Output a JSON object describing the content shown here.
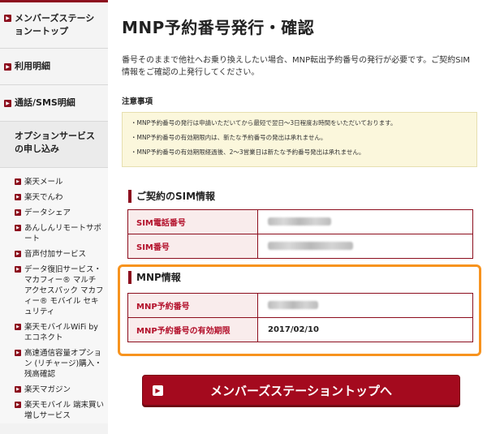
{
  "sidebar": {
    "main_items": [
      {
        "label": "メンバーズステーションートップ",
        "icon": "chevron-right-icon"
      },
      {
        "label": "利用明細",
        "icon": "chevron-right-icon"
      },
      {
        "label": "通話/SMS明細",
        "icon": "chevron-right-icon"
      }
    ],
    "section_title": "オプションサービスの申し込み",
    "sub_items": [
      {
        "label": "楽天メール"
      },
      {
        "label": "楽天でんわ"
      },
      {
        "label": "データシェア"
      },
      {
        "label": "あんしんリモートサポート"
      },
      {
        "label": "音声付加サービス"
      },
      {
        "label": "データ復旧サービス・マカフィー® マルチ アクセスパック マカフィー® モバイル セキュリティ"
      },
      {
        "label": "楽天モバイルWiFi by エコネクト"
      },
      {
        "label": "高速通信容量オプション (リチャージ)購入・残高確認"
      },
      {
        "label": "楽天マガジン"
      },
      {
        "label": "楽天モバイル 端末買い増しサービス"
      }
    ]
  },
  "main": {
    "title": "MNP予約番号発行・確認",
    "intro": "番号そのままで他社へお乗り換えしたい場合、MNP転出予約番号の発行が必要です。ご契約SIM情報をご確認の上発行してください。",
    "notes_heading": "注意事項",
    "notes": [
      "・MNP予約番号の発行は申請いただいてから最短で翌日〜3日程度お時間をいただいております。",
      "・MNP予約番号の有効期限内は、新たな予約番号の発出は承れません。",
      "・MNP予約番号の有効期限経過後、2〜3営業日は新たな予約番号発出は承れません。"
    ],
    "sim_section": {
      "heading": "ご契約のSIM情報",
      "rows": [
        {
          "label": "SIM電話番号"
        },
        {
          "label": "SIM番号"
        }
      ]
    },
    "mnp_section": {
      "heading": "MNP情報",
      "rows": [
        {
          "label": "MNP予約番号",
          "value": ""
        },
        {
          "label": "MNP予約番号の有効期限",
          "value": "2017/02/10"
        }
      ]
    },
    "top_button_label": "メンバーズステーショントップへ"
  },
  "colors": {
    "brand": "#8c0d1d",
    "highlight": "#f7931e",
    "notes_bg": "#fbf7dc"
  }
}
